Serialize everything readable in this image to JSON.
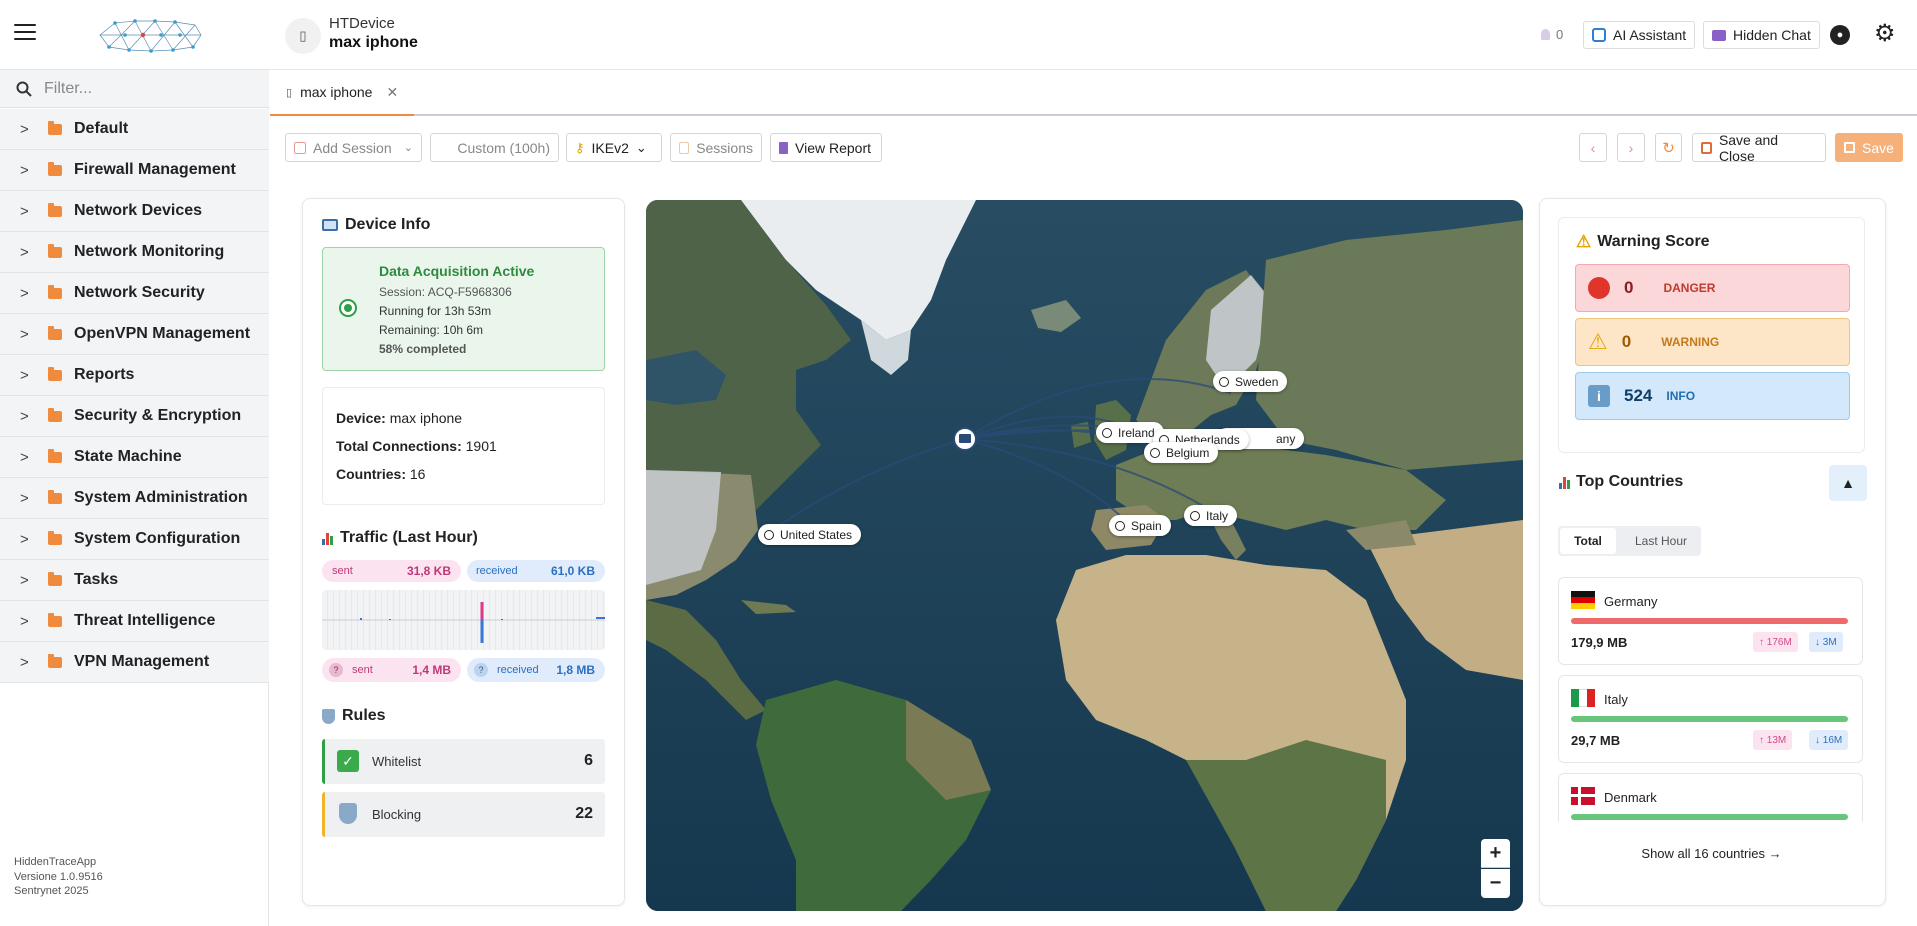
{
  "header": {
    "device_label": "HTDevice",
    "device_name": "max iphone",
    "notif_count": "0",
    "ai_label": "AI Assistant",
    "chat_label": "Hidden Chat"
  },
  "sidebar": {
    "filter_placeholder": "Filter...",
    "items": [
      {
        "label": "Default"
      },
      {
        "label": "Firewall Management"
      },
      {
        "label": "Network Devices"
      },
      {
        "label": "Network Monitoring"
      },
      {
        "label": "Network Security"
      },
      {
        "label": "OpenVPN Management"
      },
      {
        "label": "Reports"
      },
      {
        "label": "Security & Encryption"
      },
      {
        "label": "State Machine"
      },
      {
        "label": "System Administration"
      },
      {
        "label": "System Configuration"
      },
      {
        "label": "Tasks"
      },
      {
        "label": "Threat Intelligence"
      },
      {
        "label": "VPN Management"
      }
    ],
    "footer": {
      "app": "HiddenTraceApp",
      "version": "Versione 1.0.9516",
      "company": "Sentrynet 2025"
    }
  },
  "tabs": [
    {
      "label": "max iphone"
    }
  ],
  "toolbar": {
    "add_session": "Add Session",
    "custom": "Custom (100h)",
    "protocol": "IKEv2",
    "sessions": "Sessions",
    "view_report": "View Report",
    "save_close": "Save and Close",
    "save": "Save"
  },
  "device_info": {
    "title": "Device Info",
    "status_title": "Data Acquisition Active",
    "session": "Session: ACQ-F5968306",
    "running": "Running for 13h 53m",
    "remaining": "Remaining: 10h 6m",
    "completed": "58% completed",
    "device_label": "Device:",
    "device_value": "max iphone",
    "connections_label": "Total Connections:",
    "connections_value": "1901",
    "countries_label": "Countries:",
    "countries_value": "16"
  },
  "traffic": {
    "title": "Traffic (Last Hour)",
    "sent_label": "sent",
    "sent_value": "31,8 KB",
    "received_label": "received",
    "received_value": "61,0 KB",
    "total_sent_label": "sent",
    "total_sent_value": "1,4 MB",
    "total_received_label": "received",
    "total_received_value": "1,8 MB"
  },
  "rules": {
    "title": "Rules",
    "whitelist_label": "Whitelist",
    "whitelist_count": "6",
    "blocking_label": "Blocking",
    "blocking_count": "22"
  },
  "map": {
    "labels": [
      {
        "name": "Sweden"
      },
      {
        "name": "Ireland"
      },
      {
        "name": "Netherlands"
      },
      {
        "name": "Belgium"
      },
      {
        "name": "Italy"
      },
      {
        "name": "Spain"
      },
      {
        "name": "United States"
      }
    ],
    "germany_partial": "any",
    "zoom_in": "+",
    "zoom_out": "−"
  },
  "warning": {
    "title": "Warning Score",
    "danger_count": "0",
    "danger_label": "DANGER",
    "warning_count": "0",
    "warning_label": "WARNING",
    "info_count": "524",
    "info_label": "INFO"
  },
  "top_countries": {
    "title": "Top Countries",
    "tab_total": "Total",
    "tab_last_hour": "Last Hour",
    "items": [
      {
        "name": "Germany",
        "total": "179,9 MB",
        "up": "↑ 176M",
        "down": "↓ 3M"
      },
      {
        "name": "Italy",
        "total": "29,7 MB",
        "up": "↑ 13M",
        "down": "↓ 16M"
      },
      {
        "name": "Denmark"
      }
    ],
    "show_all": "Show all 16 countries →"
  },
  "colors": {
    "accent": "#f08a3c",
    "danger": "#c0392b",
    "info": "#1f6fb2"
  }
}
